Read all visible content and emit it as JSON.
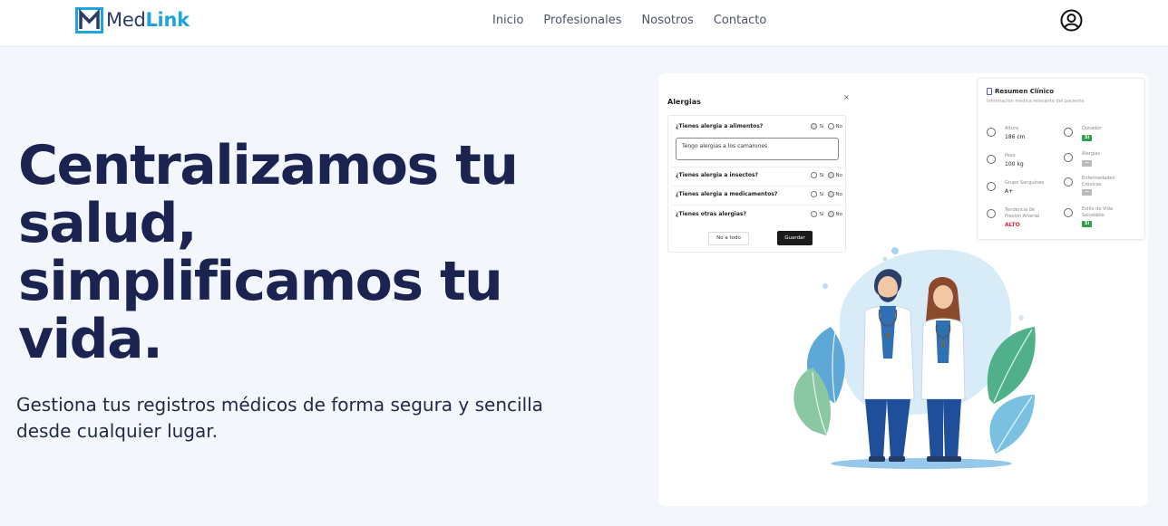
{
  "brand": {
    "med": "Med",
    "link": "Link"
  },
  "nav": {
    "items": [
      "Inicio",
      "Profesionales",
      "Nosotros",
      "Contacto"
    ]
  },
  "hero": {
    "title_lines": [
      "Centralizamos tu",
      "salud,",
      "simplificamos tu",
      "vida."
    ],
    "subtitle_lines": [
      "Gestiona tus registros médicos de forma segura y sencilla",
      "desde cualquier lugar."
    ]
  },
  "allergy_form": {
    "title": "Alergias",
    "close": "×",
    "questions": [
      {
        "text": "¿Tienes alergia a alimentos?",
        "yes": "Sí",
        "no": "No",
        "selected": "yes"
      },
      {
        "text": "¿Tienes alergia a insectos?",
        "yes": "Sí",
        "no": "No",
        "selected": "no"
      },
      {
        "text": "¿Tienes alergia a medicamentos?",
        "yes": "Sí",
        "no": "No",
        "selected": "no"
      },
      {
        "text": "¿Tienes otras alergias?",
        "yes": "Sí",
        "no": "No",
        "selected": "no"
      }
    ],
    "food_input_value": "Tengo alergias a los camarones",
    "none_button": "No a todo",
    "save_button": "Guardar"
  },
  "clinical_summary": {
    "title": "Resumen Clínico",
    "subtitle": "Información médica relevante del paciente",
    "height_label": "Altura",
    "height_value": "186 cm",
    "weight_label": "Peso",
    "weight_value": "100 kg",
    "blood_label": "Grupo Sanguíneo",
    "blood_value": "A+",
    "pressure_label_1": "Tendencia de",
    "pressure_label_2": "Presión Arterial",
    "pressure_value": "ALTO",
    "donor_label": "Donador",
    "donor_value": "Sí",
    "allergies_label": "Alergias",
    "allergies_value": "—",
    "chronic_label_1": "Enfermedades",
    "chronic_label_2": "Crónicas",
    "chronic_value": "—",
    "lifestyle_label_1": "Estilo de Vida",
    "lifestyle_label_2": "Saludable",
    "lifestyle_value": "Sí"
  },
  "colors": {
    "brand_dark": "#2a3c68",
    "brand_accent": "#1fa4dd",
    "heading": "#1b2451",
    "badge_green": "#2e9e48",
    "alert_red": "#e0293a"
  },
  "icons": [
    "medlink-logo-icon",
    "user-account-icon",
    "ruler-icon",
    "weight-icon",
    "blood-drop-icon",
    "pulse-icon",
    "heart-icon",
    "warning-icon",
    "activity-icon",
    "bike-icon",
    "clipboard-icon"
  ]
}
